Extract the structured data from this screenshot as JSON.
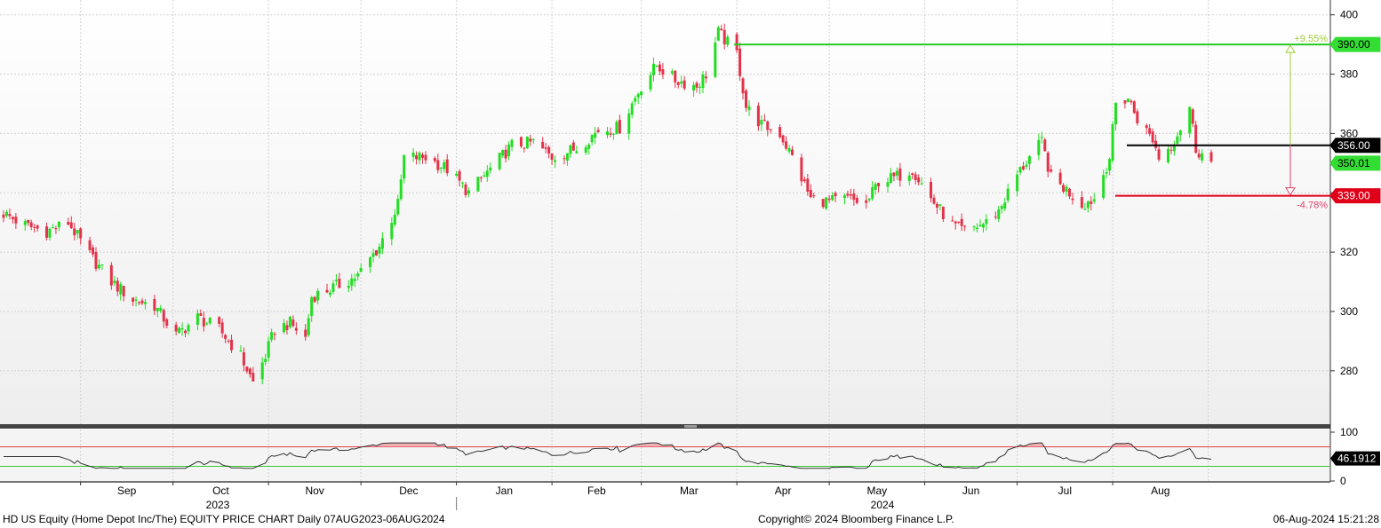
{
  "footer": {
    "left": "HD US Equity (Home Depot Inc/The) EQUITY PRICE CHART  Daily 07AUG2023-06AUG2024",
    "center": "Copyright© 2024 Bloomberg Finance L.P.",
    "right": "06-Aug-2024 15:21:28"
  },
  "colors": {
    "up": "#22dd22",
    "down": "#e3334a",
    "target_high": "#22cc22",
    "target_low": "#e0001a",
    "current_line": "#000000",
    "rsi_line": "#333333",
    "rsi_upper": "#e04040",
    "rsi_lower": "#33cc33"
  },
  "chart_data": [
    {
      "type": "candlestick",
      "title": "",
      "ylim": [
        262,
        405
      ],
      "yticks": [
        280,
        300,
        320,
        340,
        360,
        380,
        400
      ],
      "x_months": [
        "Sep",
        "Oct",
        "Nov",
        "Dec",
        "Jan",
        "Feb",
        "Mar",
        "Apr",
        "May",
        "Jun",
        "Jul",
        "Aug"
      ],
      "x_years": [
        "2023",
        "2024"
      ],
      "start_date": "2023-08-07",
      "end_date": "2024-08-06",
      "anchors": [
        [
          "2023-08-07",
          333
        ],
        [
          "2023-08-14",
          329
        ],
        [
          "2023-08-21",
          327
        ],
        [
          "2023-08-28",
          330
        ],
        [
          "2023-09-04",
          319
        ],
        [
          "2023-09-11",
          310
        ],
        [
          "2023-09-18",
          304
        ],
        [
          "2023-09-25",
          302
        ],
        [
          "2023-10-02",
          292
        ],
        [
          "2023-10-09",
          298
        ],
        [
          "2023-10-16",
          294
        ],
        [
          "2023-10-23",
          285
        ],
        [
          "2023-10-27",
          276
        ],
        [
          "2023-10-31",
          285
        ],
        [
          "2023-11-03",
          294
        ],
        [
          "2023-11-08",
          296
        ],
        [
          "2023-11-13",
          291
        ],
        [
          "2023-11-15",
          305
        ],
        [
          "2023-11-22",
          308
        ],
        [
          "2023-11-30",
          312
        ],
        [
          "2023-12-07",
          322
        ],
        [
          "2023-12-13",
          336
        ],
        [
          "2023-12-15",
          352
        ],
        [
          "2023-12-22",
          352
        ],
        [
          "2023-12-29",
          348
        ],
        [
          "2024-01-05",
          340
        ],
        [
          "2024-01-12",
          348
        ],
        [
          "2024-01-19",
          356
        ],
        [
          "2024-01-26",
          357
        ],
        [
          "2024-02-01",
          352
        ],
        [
          "2024-02-09",
          355
        ],
        [
          "2024-02-16",
          361
        ],
        [
          "2024-02-23",
          362
        ],
        [
          "2024-03-01",
          376
        ],
        [
          "2024-03-06",
          383
        ],
        [
          "2024-03-12",
          378
        ],
        [
          "2024-03-19",
          376
        ],
        [
          "2024-03-22",
          380
        ],
        [
          "2024-03-26",
          394
        ],
        [
          "2024-04-01",
          387
        ],
        [
          "2024-04-04",
          369
        ],
        [
          "2024-04-09",
          363
        ],
        [
          "2024-04-15",
          360
        ],
        [
          "2024-04-19",
          352
        ],
        [
          "2024-04-25",
          338
        ],
        [
          "2024-05-01",
          337
        ],
        [
          "2024-05-07",
          338
        ],
        [
          "2024-05-13",
          336
        ],
        [
          "2024-05-17",
          344
        ],
        [
          "2024-05-22",
          345
        ],
        [
          "2024-05-28",
          348
        ],
        [
          "2024-06-03",
          338
        ],
        [
          "2024-06-10",
          329
        ],
        [
          "2024-06-14",
          327
        ],
        [
          "2024-06-21",
          330
        ],
        [
          "2024-06-25",
          334
        ],
        [
          "2024-07-01",
          346
        ],
        [
          "2024-07-05",
          352
        ],
        [
          "2024-07-09",
          357
        ],
        [
          "2024-07-12",
          345
        ],
        [
          "2024-07-17",
          341
        ],
        [
          "2024-07-22",
          336
        ],
        [
          "2024-07-26",
          338
        ],
        [
          "2024-07-31",
          352
        ],
        [
          "2024-08-02",
          370
        ],
        [
          "2024-08-06",
          372
        ],
        [
          "2024-08-09",
          365
        ],
        [
          "2024-08-14",
          358
        ],
        [
          "2024-08-16",
          352
        ],
        [
          "2024-08-20",
          356
        ],
        [
          "2024-08-23",
          362
        ],
        [
          "2024-08-26",
          369
        ],
        [
          "2024-08-28",
          355
        ],
        [
          "2024-09-02",
          350
        ]
      ],
      "price_labels": {
        "resistance": {
          "value": 390,
          "label": "390.00",
          "pct": "+9.55%"
        },
        "current": {
          "value": 356,
          "label": "356.00"
        },
        "last": {
          "value": 350.01,
          "label": "350.01"
        },
        "support": {
          "value": 339,
          "label": "339.00",
          "pct": "-4.78%"
        }
      }
    },
    {
      "type": "line",
      "title": "",
      "ylim": [
        0,
        100
      ],
      "yticks": [
        0,
        100
      ],
      "upper_band": 70,
      "lower_band": 30,
      "last_value": 46.1912,
      "last_label": "46.1912"
    }
  ]
}
